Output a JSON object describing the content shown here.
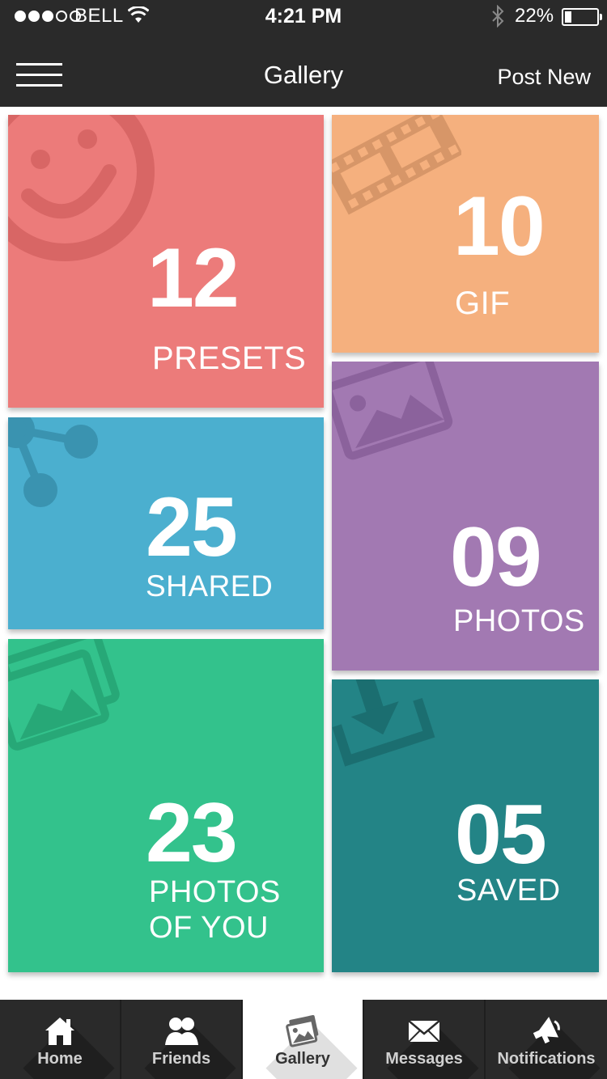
{
  "status_bar": {
    "carrier": "BELL",
    "time": "4:21 PM",
    "battery_percent": "22%",
    "battery_level": 0.22
  },
  "nav": {
    "title": "Gallery",
    "right_action": "Post New"
  },
  "tiles": [
    {
      "id": "presets",
      "count": "12",
      "label": "PRESETS",
      "color": "#ec7b7a",
      "icon": "smiley-icon"
    },
    {
      "id": "gif",
      "count": "10",
      "label": "GIF",
      "color": "#f5b07e",
      "icon": "film-strip-icon"
    },
    {
      "id": "shared",
      "count": "25",
      "label": "SHARED",
      "color": "#4bafcf",
      "icon": "share-icon"
    },
    {
      "id": "photos",
      "count": "09",
      "label": "PHOTOS",
      "color": "#a279b2",
      "icon": "photo-icon"
    },
    {
      "id": "photos-of-you",
      "count": "23",
      "label": "PHOTOS OF YOU",
      "color": "#33c28c",
      "icon": "photos-stack-icon"
    },
    {
      "id": "saved",
      "count": "05",
      "label": "SAVED",
      "color": "#238486",
      "icon": "download-icon"
    }
  ],
  "tabbar": {
    "items": [
      {
        "label": "Home",
        "icon": "home-icon",
        "active": false
      },
      {
        "label": "Friends",
        "icon": "friends-icon",
        "active": false
      },
      {
        "label": "Gallery",
        "icon": "gallery-icon",
        "active": true
      },
      {
        "label": "Messages",
        "icon": "envelope-icon",
        "active": false
      },
      {
        "label": "Notifications",
        "icon": "megaphone-icon",
        "active": false
      }
    ]
  }
}
